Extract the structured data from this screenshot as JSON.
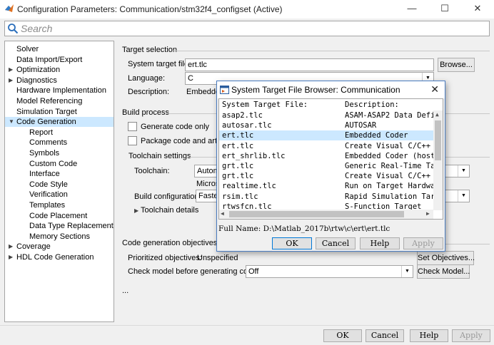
{
  "window": {
    "title": "Configuration Parameters: Communication/stm32f4_configset (Active)",
    "minimize": "—",
    "maximize": "☐",
    "close": "✕"
  },
  "search": {
    "placeholder": "Search"
  },
  "tree": {
    "items": [
      {
        "label": "Solver",
        "level": 0,
        "arrow": ""
      },
      {
        "label": "Data Import/Export",
        "level": 0,
        "arrow": ""
      },
      {
        "label": "Optimization",
        "level": 0,
        "arrow": "▶"
      },
      {
        "label": "Diagnostics",
        "level": 0,
        "arrow": "▶"
      },
      {
        "label": "Hardware Implementation",
        "level": 0,
        "arrow": ""
      },
      {
        "label": "Model Referencing",
        "level": 0,
        "arrow": ""
      },
      {
        "label": "Simulation Target",
        "level": 0,
        "arrow": ""
      },
      {
        "label": "Code Generation",
        "level": 0,
        "arrow": "▼",
        "selected": true
      },
      {
        "label": "Report",
        "level": 1,
        "arrow": ""
      },
      {
        "label": "Comments",
        "level": 1,
        "arrow": ""
      },
      {
        "label": "Symbols",
        "level": 1,
        "arrow": ""
      },
      {
        "label": "Custom Code",
        "level": 1,
        "arrow": ""
      },
      {
        "label": "Interface",
        "level": 1,
        "arrow": ""
      },
      {
        "label": "Code Style",
        "level": 1,
        "arrow": ""
      },
      {
        "label": "Verification",
        "level": 1,
        "arrow": ""
      },
      {
        "label": "Templates",
        "level": 1,
        "arrow": ""
      },
      {
        "label": "Code Placement",
        "level": 1,
        "arrow": ""
      },
      {
        "label": "Data Type Replacement",
        "level": 1,
        "arrow": ""
      },
      {
        "label": "Memory Sections",
        "level": 1,
        "arrow": ""
      },
      {
        "label": "Coverage",
        "level": 0,
        "arrow": "▶"
      },
      {
        "label": "HDL Code Generation",
        "level": 0,
        "arrow": "▶"
      }
    ]
  },
  "target_selection": {
    "heading": "Target selection",
    "system_target_label": "System target file:",
    "system_target_value": "ert.tlc",
    "browse": "Browse...",
    "language_label": "Language:",
    "language_value": "C",
    "description_label": "Description:",
    "description_value": "Embedde"
  },
  "build_process": {
    "heading": "Build process",
    "generate_code_only": "Generate code only",
    "package_code": "Package code and artifac",
    "toolchain_settings": "Toolchain settings",
    "toolchain_label": "Toolchain:",
    "toolchain_value": "Autom",
    "toolchain_sub": "Micros",
    "build_config_label": "Build configuration:",
    "build_config_value": "Faste",
    "toolchain_details": "Toolchain details"
  },
  "objectives": {
    "heading": "Code generation objectives",
    "prioritized_label": "Prioritized objectives:",
    "prioritized_value": "Unspecified",
    "set_objectives": "Set Objectives...",
    "check_model_label": "Check model before generating code:",
    "check_model_value": "Off",
    "check_model_btn": "Check Model...",
    "ellipsis": "..."
  },
  "bottom_buttons": {
    "ok": "OK",
    "cancel": "Cancel",
    "help": "Help",
    "apply": "Apply"
  },
  "dialog": {
    "title": "System Target File Browser: Communication",
    "close": "✕",
    "col_file": "System Target File:",
    "col_desc": "Description:",
    "rows": [
      {
        "file": "asap2.tlc",
        "desc": "ASAM-ASAP2 Data Defi"
      },
      {
        "file": "autosar.tlc",
        "desc": "AUTOSAR"
      },
      {
        "file": "ert.tlc",
        "desc": "Embedded Coder",
        "selected": true
      },
      {
        "file": "ert.tlc",
        "desc": "Create Visual C/C++"
      },
      {
        "file": "ert_shrlib.tlc",
        "desc": "Embedded Coder (host"
      },
      {
        "file": "grt.tlc",
        "desc": "Generic Real-Time Ta"
      },
      {
        "file": "grt.tlc",
        "desc": "Create Visual C/C++"
      },
      {
        "file": "realtime.tlc",
        "desc": "Run on Target Hardwa"
      },
      {
        "file": "rsim.tlc",
        "desc": "Rapid Simulation Tar"
      },
      {
        "file": "rtwsfcn.tlc",
        "desc": "S-Function Target"
      }
    ],
    "full_name": "Full Name: D:\\Matlab_2017b\\rtw\\c\\ert\\ert.tlc",
    "ok": "OK",
    "cancel": "Cancel",
    "help": "Help",
    "apply": "Apply"
  }
}
